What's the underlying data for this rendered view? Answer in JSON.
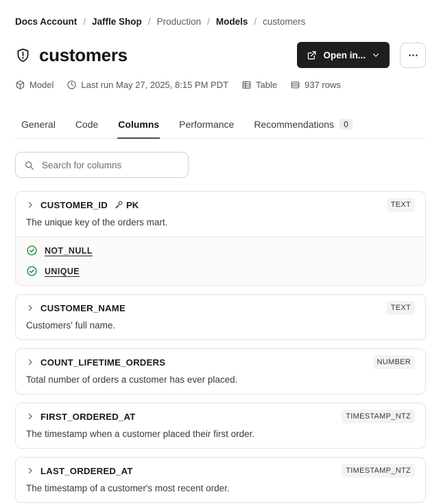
{
  "breadcrumb": {
    "separator": "/",
    "items": [
      {
        "label": "Docs Account",
        "muted": false
      },
      {
        "label": "Jaffle Shop",
        "muted": false
      },
      {
        "label": "Production",
        "muted": true
      },
      {
        "label": "Models",
        "muted": false
      },
      {
        "label": "customers",
        "muted": true
      }
    ]
  },
  "header": {
    "title": "customers",
    "open_in_label": "Open in..."
  },
  "meta": {
    "resource_type": "Model",
    "last_run": "Last run May 27, 2025, 8:15 PM PDT",
    "materialization": "Table",
    "row_count": "937 rows"
  },
  "tabs": [
    {
      "label": "General",
      "active": false,
      "badge": null
    },
    {
      "label": "Code",
      "active": false,
      "badge": null
    },
    {
      "label": "Columns",
      "active": true,
      "badge": null
    },
    {
      "label": "Performance",
      "active": false,
      "badge": null
    },
    {
      "label": "Recommendations",
      "active": false,
      "badge": "0"
    }
  ],
  "search": {
    "placeholder": "Search for columns"
  },
  "columns": [
    {
      "name": "CUSTOMER_ID",
      "pk_label": "PK",
      "type": "TEXT",
      "description": "The unique key of the orders mart.",
      "tests": [
        "NOT_NULL",
        "UNIQUE"
      ]
    },
    {
      "name": "CUSTOMER_NAME",
      "pk_label": null,
      "type": "TEXT",
      "description": "Customers' full name.",
      "tests": []
    },
    {
      "name": "COUNT_LIFETIME_ORDERS",
      "pk_label": null,
      "type": "NUMBER",
      "description": "Total number of orders a customer has ever placed.",
      "tests": []
    },
    {
      "name": "FIRST_ORDERED_AT",
      "pk_label": null,
      "type": "TIMESTAMP_NTZ",
      "description": "The timestamp when a customer placed their first order.",
      "tests": []
    },
    {
      "name": "LAST_ORDERED_AT",
      "pk_label": null,
      "type": "TIMESTAMP_NTZ",
      "description": "The timestamp of a customer's most recent order.",
      "tests": []
    }
  ],
  "colors": {
    "primary_button_bg": "#1e1e21",
    "test_pass_green": "#1d8236",
    "badge_bg": "#f3f3f5",
    "border": "#e4e4e8"
  }
}
